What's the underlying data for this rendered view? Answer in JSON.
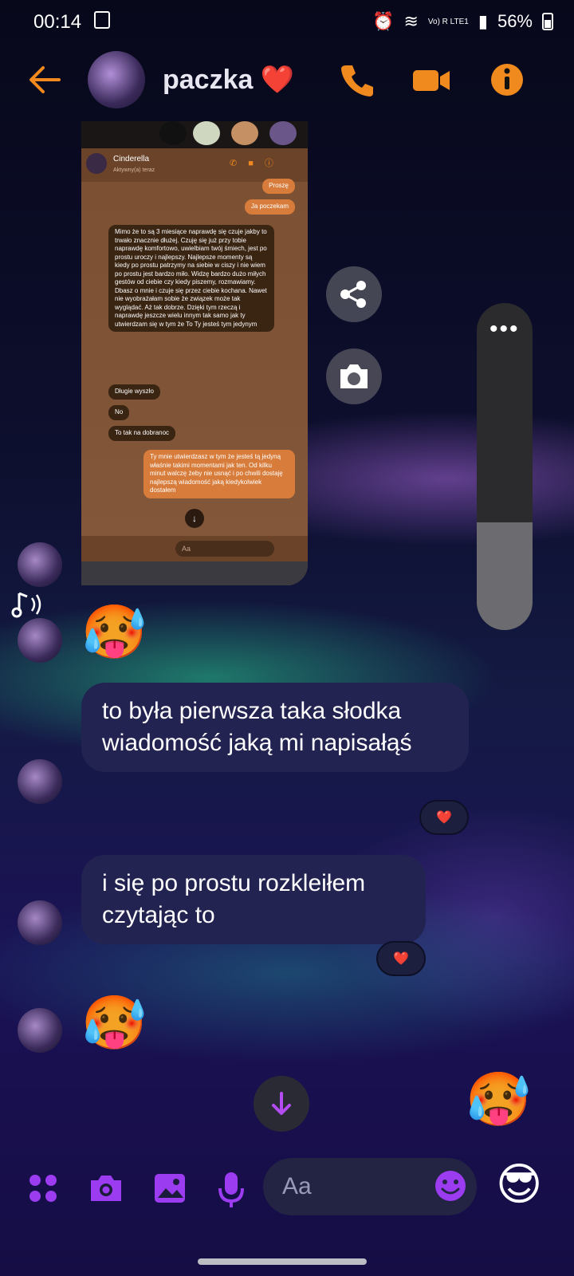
{
  "status": {
    "time": "00:14",
    "battery": "56%",
    "network": "Vo) R LTE1"
  },
  "header": {
    "title": "paczka",
    "title_emoji": "❤️"
  },
  "screenshot": {
    "contact_name": "Cinderella",
    "contact_sub": "Aktywny(a) teraz",
    "messages": [
      {
        "dir": "out",
        "text": "Proszę"
      },
      {
        "dir": "out",
        "text": "Ja poczekam"
      },
      {
        "dir": "in",
        "text": "Mimo że to są 3 miesiące naprawdę się czuje jakby to trwało znacznie dłużej. Czuję się już przy tobie naprawdę komfortowo, uwielbiam twój śmiech, jest po prostu uroczy i najlepszy. Najlepsze momenty są kiedy po prostu patrzymy na siebie w ciszy i nie wiem po prostu jest bardzo miło. Widzę bardzo dużo miłych gestów od ciebie czy kiedy piszemy, rozmawiamy. Dbasz o mnie i czuje się przez ciebie kochana. Nawet nie wyobrażałam sobie że związek może tak wyglądać. Aż tak dobrze. Dzięki tym rzeczą i naprawdę jeszcze wielu innym tak samo jak ty utwierdzam się w tym że To Ty jesteś tym jedynym"
      },
      {
        "dir": "in",
        "text": "Długie wyszło"
      },
      {
        "dir": "in",
        "text": "No"
      },
      {
        "dir": "in",
        "text": "To tak na dobranoc"
      },
      {
        "dir": "out",
        "text": "Ty mnie utwierdzasz w tym że jesteś tą jedyną właśnie takimi momentami jak ten. Od kilku minut walczę żeby nie usnąć i po chwili dostaję najlepszą wiadomość jaką kiedykolwiek dostałem"
      }
    ],
    "composer_placeholder": "Aa"
  },
  "messages": {
    "emoji_1": "🥵",
    "bubble_1": "to była pierwsza taka słodka wiadomość jaką mi napisałąś",
    "reaction_1": "❤️",
    "bubble_2": "i się po prostu rozkleiłem czytając to",
    "reaction_2": "❤️",
    "emoji_2": "🥵",
    "emoji_3": "🥵"
  },
  "volume": {
    "level": 0.33
  },
  "composer": {
    "placeholder": "Aa",
    "quick_emoji": "😎"
  },
  "colors": {
    "accent": "#f08a1e",
    "purple": "#9b3cf0",
    "bubble": "#232352"
  }
}
